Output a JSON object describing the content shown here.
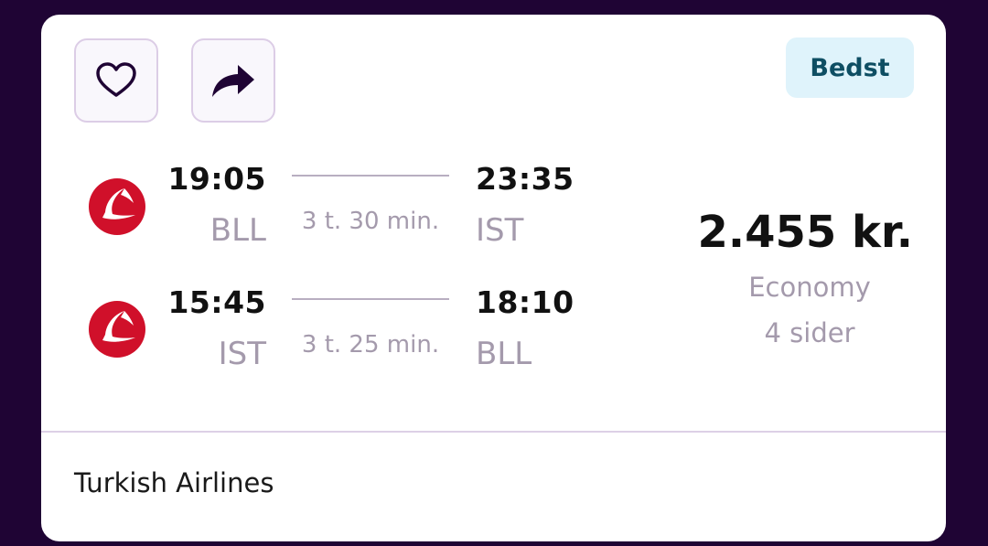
{
  "badge": "Bedst",
  "icons": {
    "favorite": "heart-icon",
    "share": "share-arrow-icon",
    "airline_logo": "turkish-airlines-logo"
  },
  "outbound": {
    "dep_time": "19:05",
    "dep_airport": "BLL",
    "arr_time": "23:35",
    "arr_airport": "IST",
    "duration": "3 t. 30 min."
  },
  "inbound": {
    "dep_time": "15:45",
    "dep_airport": "IST",
    "arr_time": "18:10",
    "arr_airport": "BLL",
    "duration": "3 t. 25 min."
  },
  "price": {
    "amount": "2.455 kr.",
    "cabin": "Economy",
    "sites": "4 sider"
  },
  "airline": "Turkish Airlines",
  "colors": {
    "background": "#1f0434",
    "badge_bg": "#dff3fb",
    "badge_text": "#0e4e63",
    "logo_red": "#d0102a",
    "muted_text": "#a49aac"
  }
}
